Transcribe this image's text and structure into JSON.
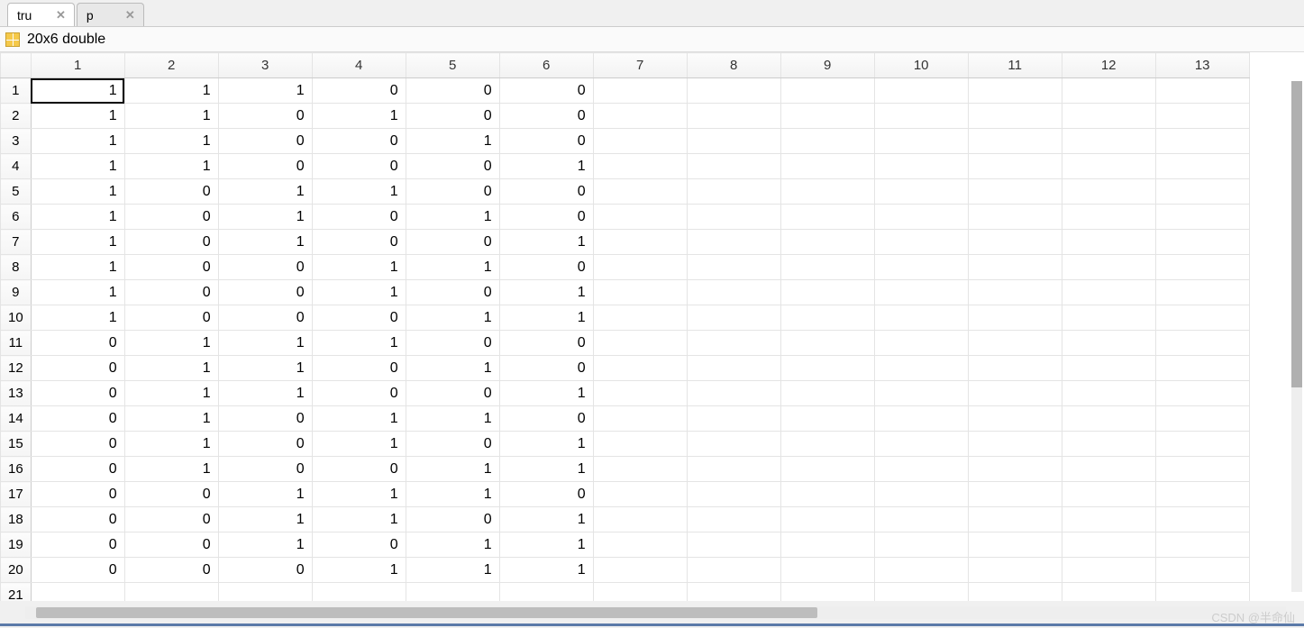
{
  "tabs": [
    {
      "label": "tru",
      "active": true
    },
    {
      "label": "p",
      "active": false
    }
  ],
  "type_label": "20x6 double",
  "col_headers": [
    "1",
    "2",
    "3",
    "4",
    "5",
    "6",
    "7",
    "8",
    "9",
    "10",
    "11",
    "12",
    "13"
  ],
  "row_headers": [
    "1",
    "2",
    "3",
    "4",
    "5",
    "6",
    "7",
    "8",
    "9",
    "10",
    "11",
    "12",
    "13",
    "14",
    "15",
    "16",
    "17",
    "18",
    "19",
    "20",
    "21"
  ],
  "rows": [
    [
      "1",
      "1",
      "1",
      "0",
      "0",
      "0"
    ],
    [
      "1",
      "1",
      "0",
      "1",
      "0",
      "0"
    ],
    [
      "1",
      "1",
      "0",
      "0",
      "1",
      "0"
    ],
    [
      "1",
      "1",
      "0",
      "0",
      "0",
      "1"
    ],
    [
      "1",
      "0",
      "1",
      "1",
      "0",
      "0"
    ],
    [
      "1",
      "0",
      "1",
      "0",
      "1",
      "0"
    ],
    [
      "1",
      "0",
      "1",
      "0",
      "0",
      "1"
    ],
    [
      "1",
      "0",
      "0",
      "1",
      "1",
      "0"
    ],
    [
      "1",
      "0",
      "0",
      "1",
      "0",
      "1"
    ],
    [
      "1",
      "0",
      "0",
      "0",
      "1",
      "1"
    ],
    [
      "0",
      "1",
      "1",
      "1",
      "0",
      "0"
    ],
    [
      "0",
      "1",
      "1",
      "0",
      "1",
      "0"
    ],
    [
      "0",
      "1",
      "1",
      "0",
      "0",
      "1"
    ],
    [
      "0",
      "1",
      "0",
      "1",
      "1",
      "0"
    ],
    [
      "0",
      "1",
      "0",
      "1",
      "0",
      "1"
    ],
    [
      "0",
      "1",
      "0",
      "0",
      "1",
      "1"
    ],
    [
      "0",
      "0",
      "1",
      "1",
      "1",
      "0"
    ],
    [
      "0",
      "0",
      "1",
      "1",
      "0",
      "1"
    ],
    [
      "0",
      "0",
      "1",
      "0",
      "1",
      "1"
    ],
    [
      "0",
      "0",
      "0",
      "1",
      "1",
      "1"
    ]
  ],
  "selected": {
    "row": 0,
    "col": 0
  },
  "watermark": "CSDN @半命仙"
}
